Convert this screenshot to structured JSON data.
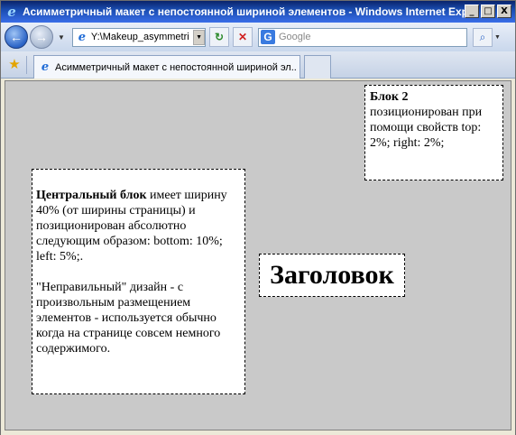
{
  "window": {
    "title": "Асимметричный макет с непостоянной шириной элементов - Windows Internet Expl...",
    "minimize_label": "_",
    "maximize_label": "□",
    "close_label": "X"
  },
  "addressbar": {
    "url": "Y:\\Makeup_asymmetri",
    "search_placeholder": "Google",
    "back_glyph": "←",
    "forward_glyph": "→",
    "refresh_glyph": "↻",
    "stop_glyph": "✕",
    "search_glyph": "⌕"
  },
  "tabs": [
    {
      "label": "Асимметричный макет с непостоянной шириной эл..."
    }
  ],
  "page": {
    "block2_bold": "Блок 2",
    "block2_text": "позиционирован при помощи свойств top: 2%; right: 2%;",
    "central_bold": "Центральный блок",
    "central_text": " имеет ширину 40% (от ширины страницы) и позиционирован абсолютно следующим образом: bottom: 10%; left: 5%;.",
    "central_para2": "\"Неправильный\" дизайн - с произвольным размещением элементов - используется обычно когда на странице совсем немного содержимого.",
    "heading": "Заголовок"
  },
  "icons": {
    "ie_icon": "ie-logo-icon",
    "favorites_icon": "star-icon",
    "google_icon": "google-icon"
  },
  "colors": {
    "title_bar": "#0a246a",
    "page_background": "#c9c9c9"
  }
}
